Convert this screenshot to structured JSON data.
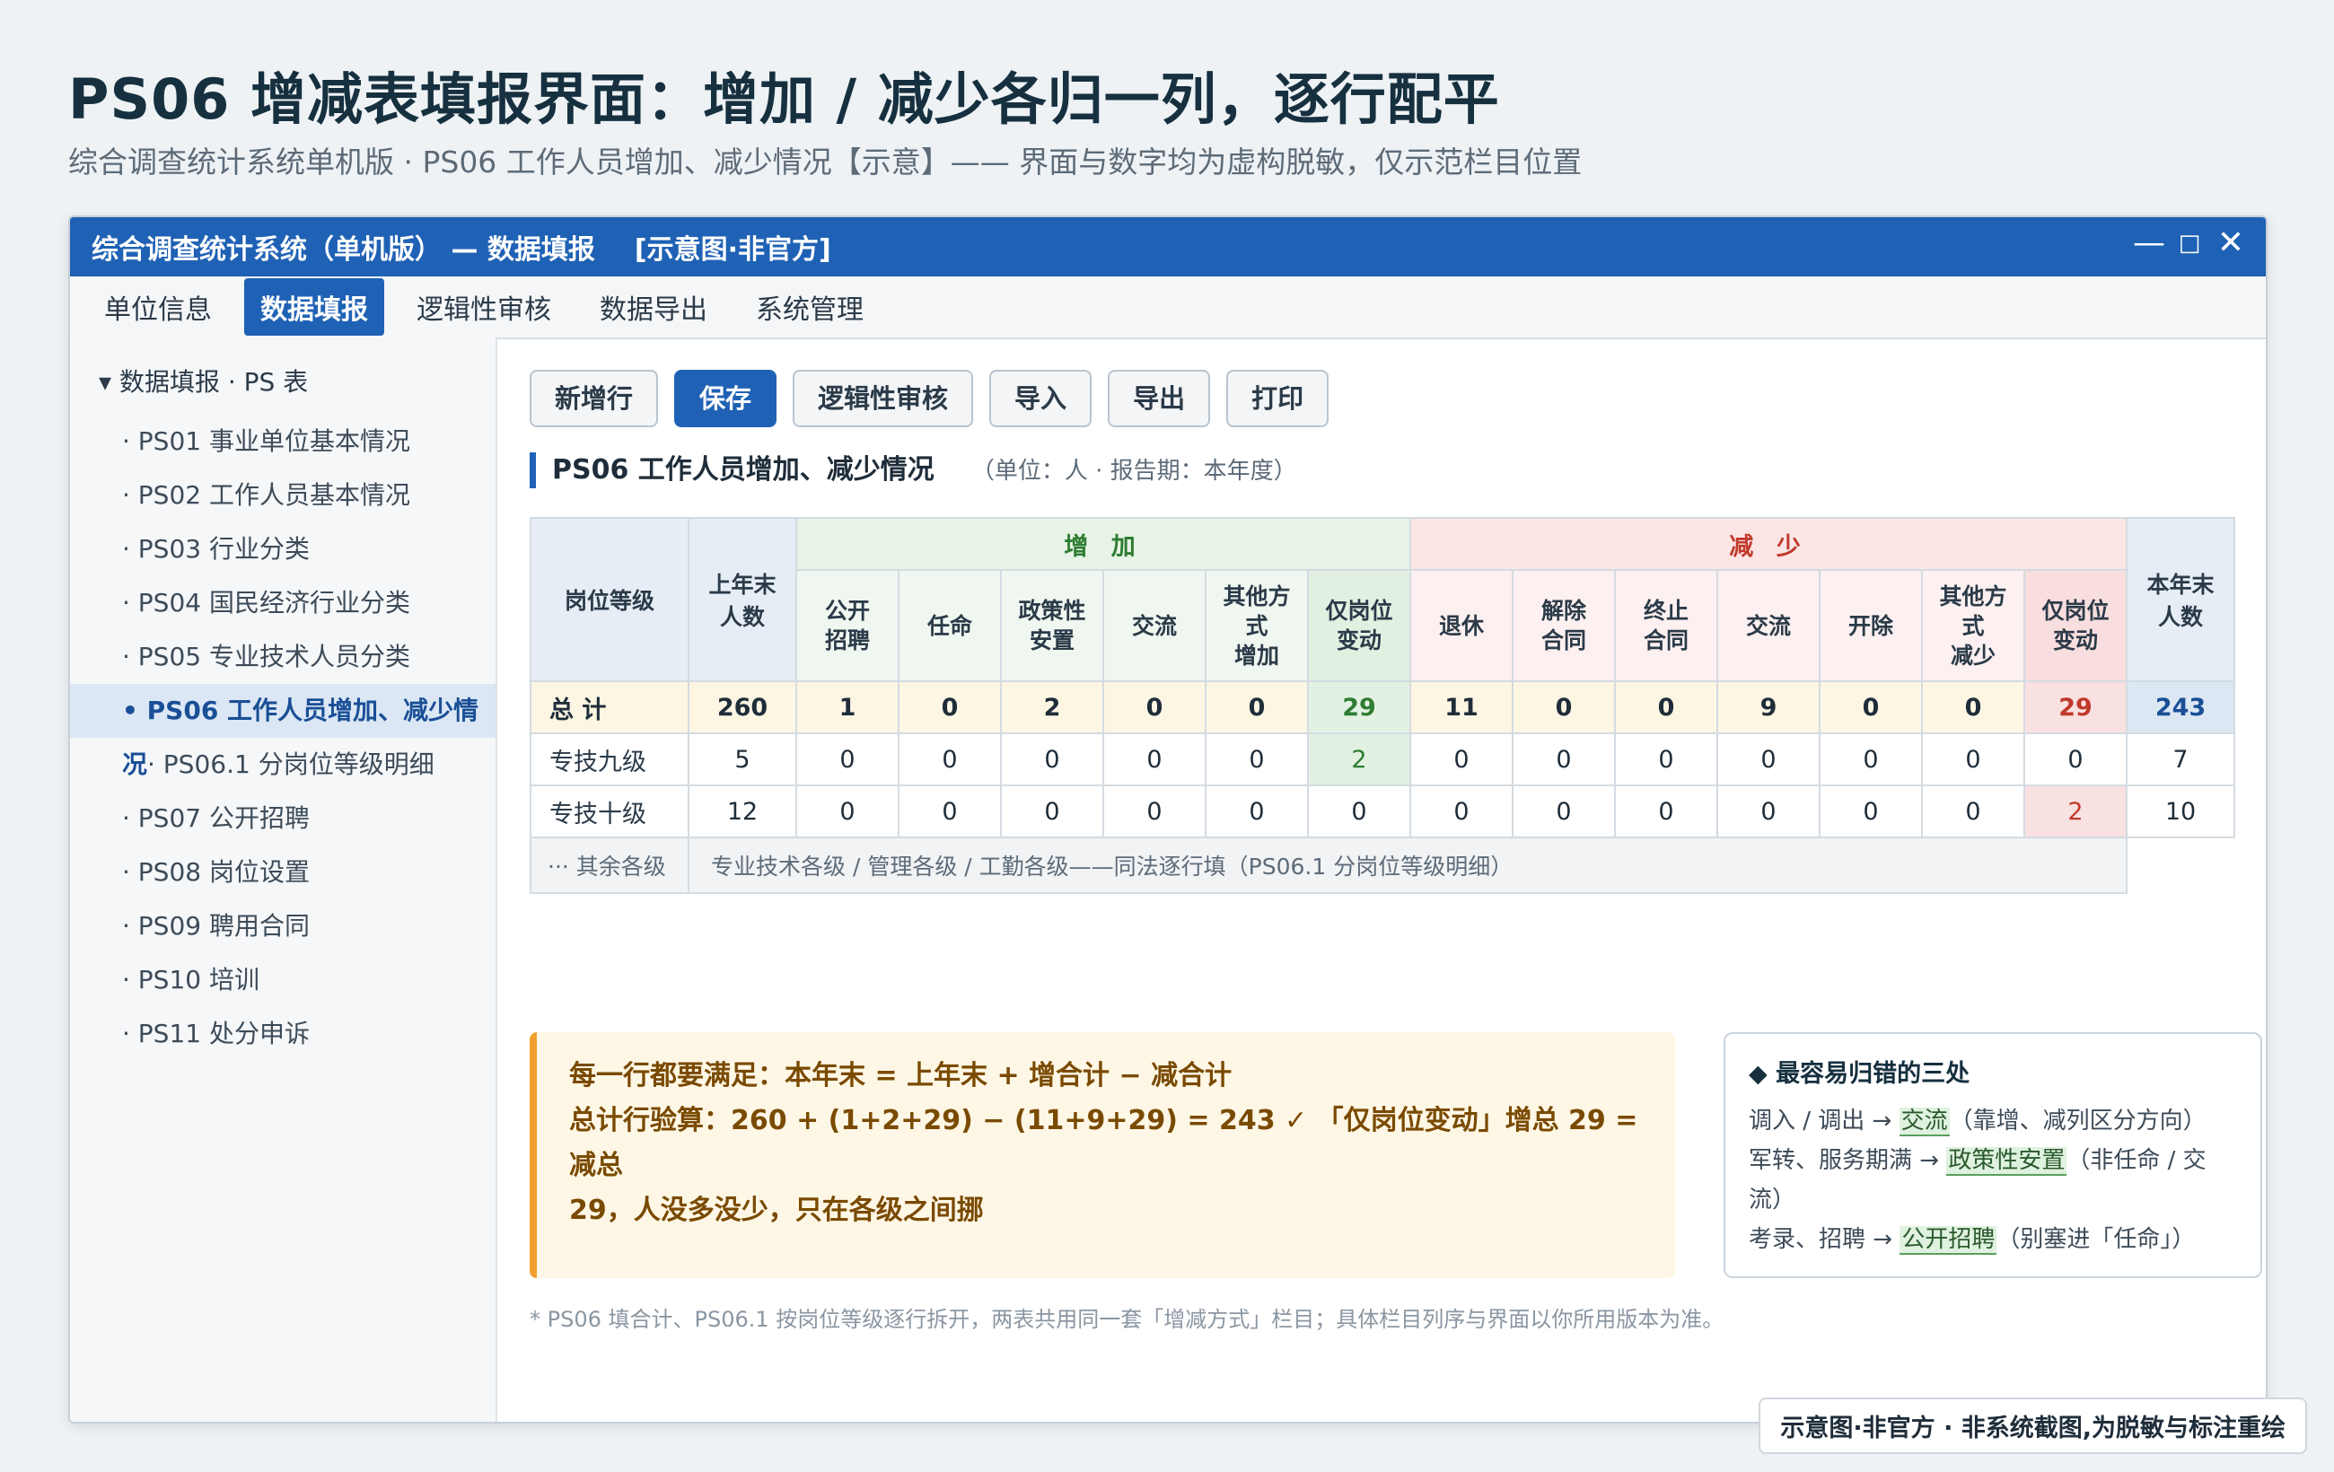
{
  "page": {
    "title": "PS06 增减表填报界面：增加 / 减少各归一列，逐行配平",
    "subtitle": "综合调查统计系统单机版 · PS06 工作人员增加、减少情况【示意】—— 界面与数字均为虚构脱敏，仅示范栏目位置"
  },
  "window": {
    "title": "综合调查统计系统（单机版） — 数据填报",
    "tag": "[示意图·非官方]",
    "controls": [
      "—",
      "□",
      "✕"
    ]
  },
  "menu": [
    "单位信息",
    "数据填报",
    "逻辑性审核",
    "数据导出",
    "系统管理"
  ],
  "sidebar": {
    "root": "▾ 数据填报 · PS 表",
    "items": [
      "· PS01 事业单位基本情况",
      "· PS02 工作人员基本情况",
      "· PS03 行业分类",
      "· PS04 国民经济行业分类",
      "· PS05 专业技术人员分类",
      "• PS06 工作人员增加、减少情况",
      "· PS06.1 分岗位等级明细",
      "· PS07 公开招聘",
      "· PS08 岗位设置",
      "· PS09 聘用合同",
      "· PS10 培训",
      "· PS11 处分申诉"
    ]
  },
  "toolbar": [
    "新增行",
    "保存",
    "逻辑性审核",
    "导入",
    "导出",
    "打印"
  ],
  "section": {
    "title": "PS06 工作人员增加、减少情况",
    "unit": "（单位：人 · 报告期：本年度）"
  },
  "table": {
    "h_level": "岗位等级",
    "h_last": [
      "上年末",
      "人数"
    ],
    "h_inc": "增 加",
    "h_dec": "减 少",
    "h_end": [
      "本年末",
      "人数"
    ],
    "inc_cols": [
      [
        "公开",
        "招聘"
      ],
      [
        "任命"
      ],
      [
        "政策性",
        "安置"
      ],
      [
        "交流"
      ],
      [
        "其他方",
        "式",
        "增加"
      ],
      [
        "仅岗位",
        "变动"
      ]
    ],
    "dec_cols": [
      [
        "退休"
      ],
      [
        "解除",
        "合同"
      ],
      [
        "终止",
        "合同"
      ],
      [
        "交流"
      ],
      [
        "开除"
      ],
      [
        "其他方",
        "式",
        "减少"
      ],
      [
        "仅岗位",
        "变动"
      ]
    ],
    "rows": [
      {
        "label": "总 计",
        "values": [
          "260",
          "1",
          "0",
          "2",
          "0",
          "0",
          "29",
          "11",
          "0",
          "0",
          "9",
          "0",
          "0",
          "29",
          "243"
        ]
      },
      {
        "label": "专技九级",
        "values": [
          "5",
          "0",
          "0",
          "0",
          "0",
          "0",
          "2",
          "0",
          "0",
          "0",
          "0",
          "0",
          "0",
          "0",
          "7"
        ]
      },
      {
        "label": "专技十级",
        "values": [
          "12",
          "0",
          "0",
          "0",
          "0",
          "0",
          "0",
          "0",
          "0",
          "0",
          "0",
          "0",
          "0",
          "2",
          "10"
        ]
      }
    ],
    "rest_label": "··· 其余各级",
    "rest_text": "专业技术各级 / 管理各级 / 工勤各级——同法逐行填（PS06.1 分岗位等级明细）"
  },
  "rule": {
    "line1": "每一行都要满足：本年末 = 上年末 + 增合计 − 减合计",
    "line2": "总计行验算：260 + (1+2+29) − (11+9+29) = 243 ✓ 「仅岗位变动」增总 29 = 减总",
    "line3": "29，人没多没少，只在各级之间挪"
  },
  "tips": {
    "title": "◆ 最容易归错的三处",
    "items": [
      {
        "pre": "调入 / 调出 → ",
        "hl": "交流",
        "post": "（靠增、减列区分方向）"
      },
      {
        "pre": "军转、服务期满 → ",
        "hl": "政策性安置",
        "post": "（非任命 / 交流）"
      },
      {
        "pre": "考录、招聘 → ",
        "hl": "公开招聘",
        "post": "（别塞进「任命」）"
      }
    ]
  },
  "footnote": "* PS06 填合计、PS06.1 按岗位等级逐行拆开，两表共用同一套「增减方式」栏目；具体栏目列序与界面以你所用版本为准。",
  "badge": "示意图·非官方 · 非系统截图,为脱敏与标注重绘",
  "colors": {
    "accent": "#1f62b5",
    "increase": "#2e7d32",
    "decrease": "#c0392b",
    "warning": "#f0a030"
  }
}
